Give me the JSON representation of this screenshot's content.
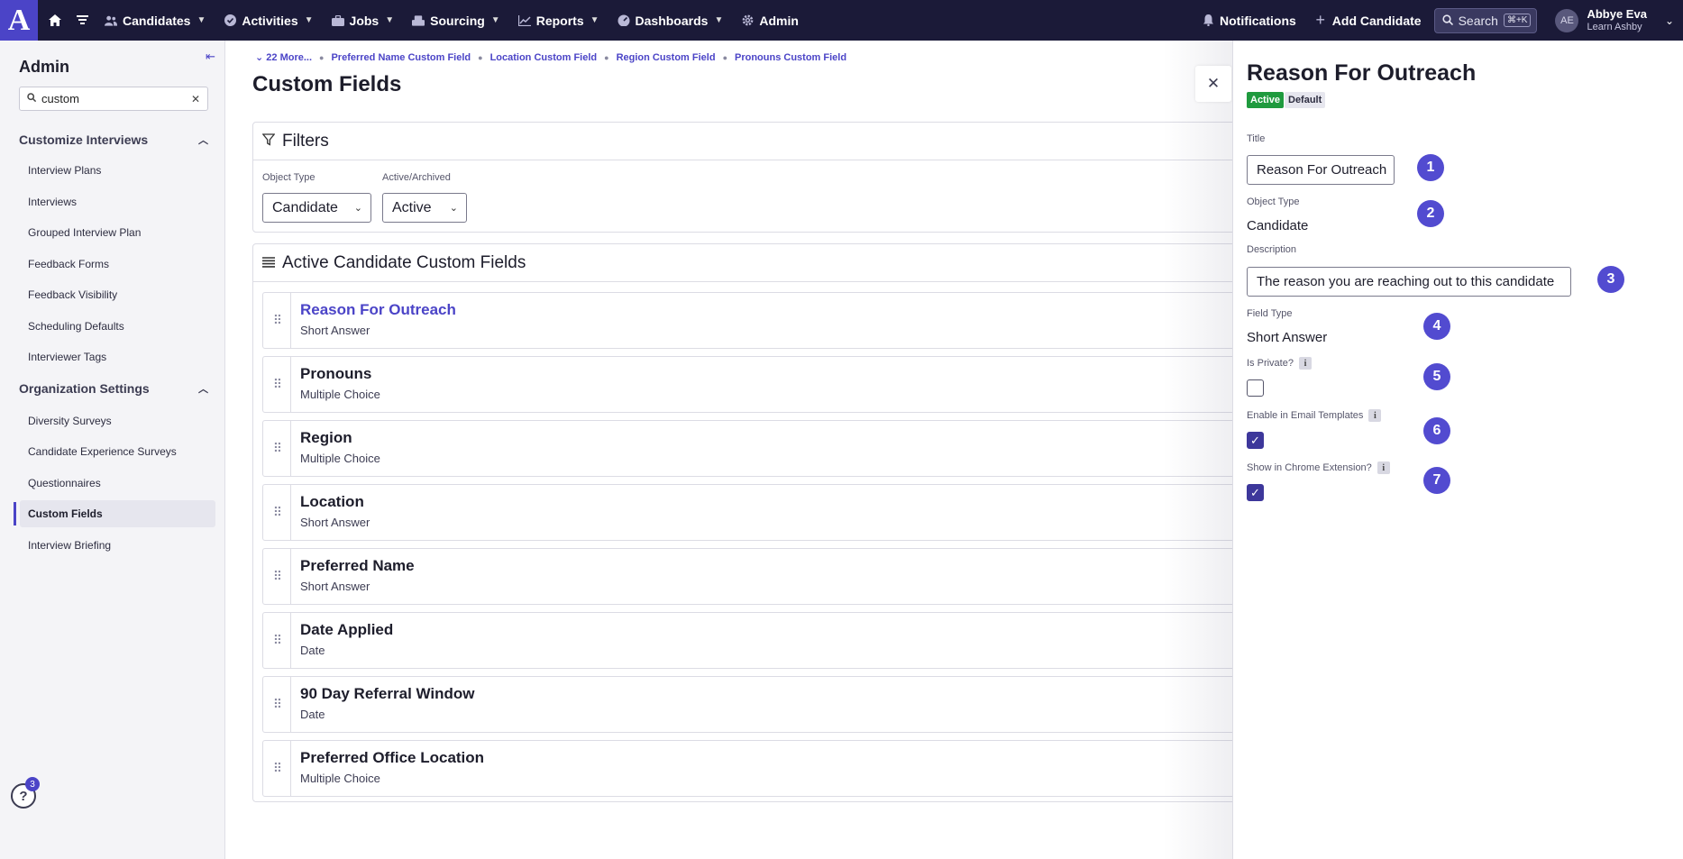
{
  "nav": {
    "items": [
      {
        "label": "Candidates",
        "icon": "users-icon"
      },
      {
        "label": "Activities",
        "icon": "check-circle-icon"
      },
      {
        "label": "Jobs",
        "icon": "briefcase-icon"
      },
      {
        "label": "Sourcing",
        "icon": "sourcing-icon"
      },
      {
        "label": "Reports",
        "icon": "chart-icon"
      },
      {
        "label": "Dashboards",
        "icon": "dashboard-icon"
      },
      {
        "label": "Admin",
        "icon": "gear-icon"
      }
    ],
    "notifications": "Notifications",
    "add_candidate": "Add Candidate",
    "search_label": "Search",
    "search_shortcut": "⌘+K",
    "user_initials": "AE",
    "user_name": "Abbye Eva",
    "user_org": "Learn Ashby"
  },
  "sidebar": {
    "title": "Admin",
    "search_value": "custom",
    "sections": [
      {
        "label": "Customize Interviews",
        "items": [
          "Interview Plans",
          "Interviews",
          "Grouped Interview Plan",
          "Feedback Forms",
          "Feedback Visibility",
          "Scheduling Defaults",
          "Interviewer Tags"
        ]
      },
      {
        "label": "Organization Settings",
        "items": [
          "Diversity Surveys",
          "Candidate Experience Surveys",
          "Questionnaires",
          "Custom Fields",
          "Interview Briefing"
        ]
      }
    ],
    "active_item": "Custom Fields",
    "help_badge": "3"
  },
  "breadcrumb": [
    "22 More...",
    "Preferred Name Custom Field",
    "Location Custom Field",
    "Region Custom Field",
    "Pronouns Custom Field"
  ],
  "page_title": "Custom Fields",
  "filters": {
    "title": "Filters",
    "object_type_label": "Object Type",
    "object_type_value": "Candidate",
    "status_label": "Active/Archived",
    "status_value": "Active"
  },
  "list": {
    "title": "Active Candidate Custom Fields",
    "rows": [
      {
        "title": "Reason For Outreach",
        "type": "Short Answer"
      },
      {
        "title": "Pronouns",
        "type": "Multiple Choice"
      },
      {
        "title": "Region",
        "type": "Multiple Choice"
      },
      {
        "title": "Location",
        "type": "Short Answer"
      },
      {
        "title": "Preferred Name",
        "type": "Short Answer"
      },
      {
        "title": "Date Applied",
        "type": "Date"
      },
      {
        "title": "90 Day Referral Window",
        "type": "Date"
      },
      {
        "title": "Preferred Office Location",
        "type": "Multiple Choice"
      }
    ]
  },
  "drawer": {
    "title": "Reason For Outreach",
    "badge_active": "Active",
    "badge_default": "Default",
    "title_label": "Title",
    "title_value": "Reason For Outreach",
    "object_type_label": "Object Type",
    "object_type_value": "Candidate",
    "description_label": "Description",
    "description_value": "The reason you are reaching out to this candidate",
    "field_type_label": "Field Type",
    "field_type_value": "Short Answer",
    "is_private_label": "Is Private?",
    "is_private_checked": false,
    "email_templates_label": "Enable in Email Templates",
    "email_templates_checked": true,
    "chrome_label": "Show in Chrome Extension?",
    "chrome_checked": true,
    "markers": [
      "1",
      "2",
      "3",
      "4",
      "5",
      "6",
      "7"
    ]
  },
  "colors": {
    "nav_bg": "#1b1a38",
    "accent": "#4b44c7",
    "active_badge": "#1f9a3e"
  }
}
